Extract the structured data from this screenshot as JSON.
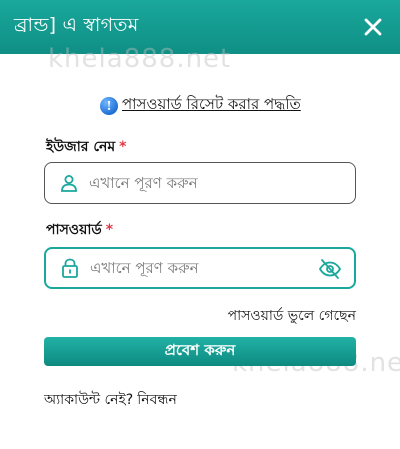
{
  "header": {
    "title": "ব্রান্ড] এ স্বাগতম",
    "close_icon": "close-icon"
  },
  "watermark": "khela888.net",
  "help": {
    "icon": "info-icon",
    "label": "পাসওয়ার্ড রিসেট করার পদ্ধতি"
  },
  "username": {
    "label": "ইউজার নেম",
    "required_mark": "*",
    "placeholder": "এখানে পূরণ করুন",
    "icon": "user-icon"
  },
  "password": {
    "label": "পাসওয়ার্ড",
    "required_mark": "*",
    "placeholder": "এখানে পূরণ করুন",
    "icon": "lock-icon",
    "toggle_icon": "eye-hidden-icon"
  },
  "forgot_label": "পাসওয়ার্ড ভুলে গেছেন",
  "submit_label": "প্রবেশ করুন",
  "register": {
    "prompt": "অ্যাকাউন্ট নেই?",
    "link": "নিবন্ধন"
  },
  "colors": {
    "accent": "#1aa89c",
    "required": "#e0384a"
  }
}
